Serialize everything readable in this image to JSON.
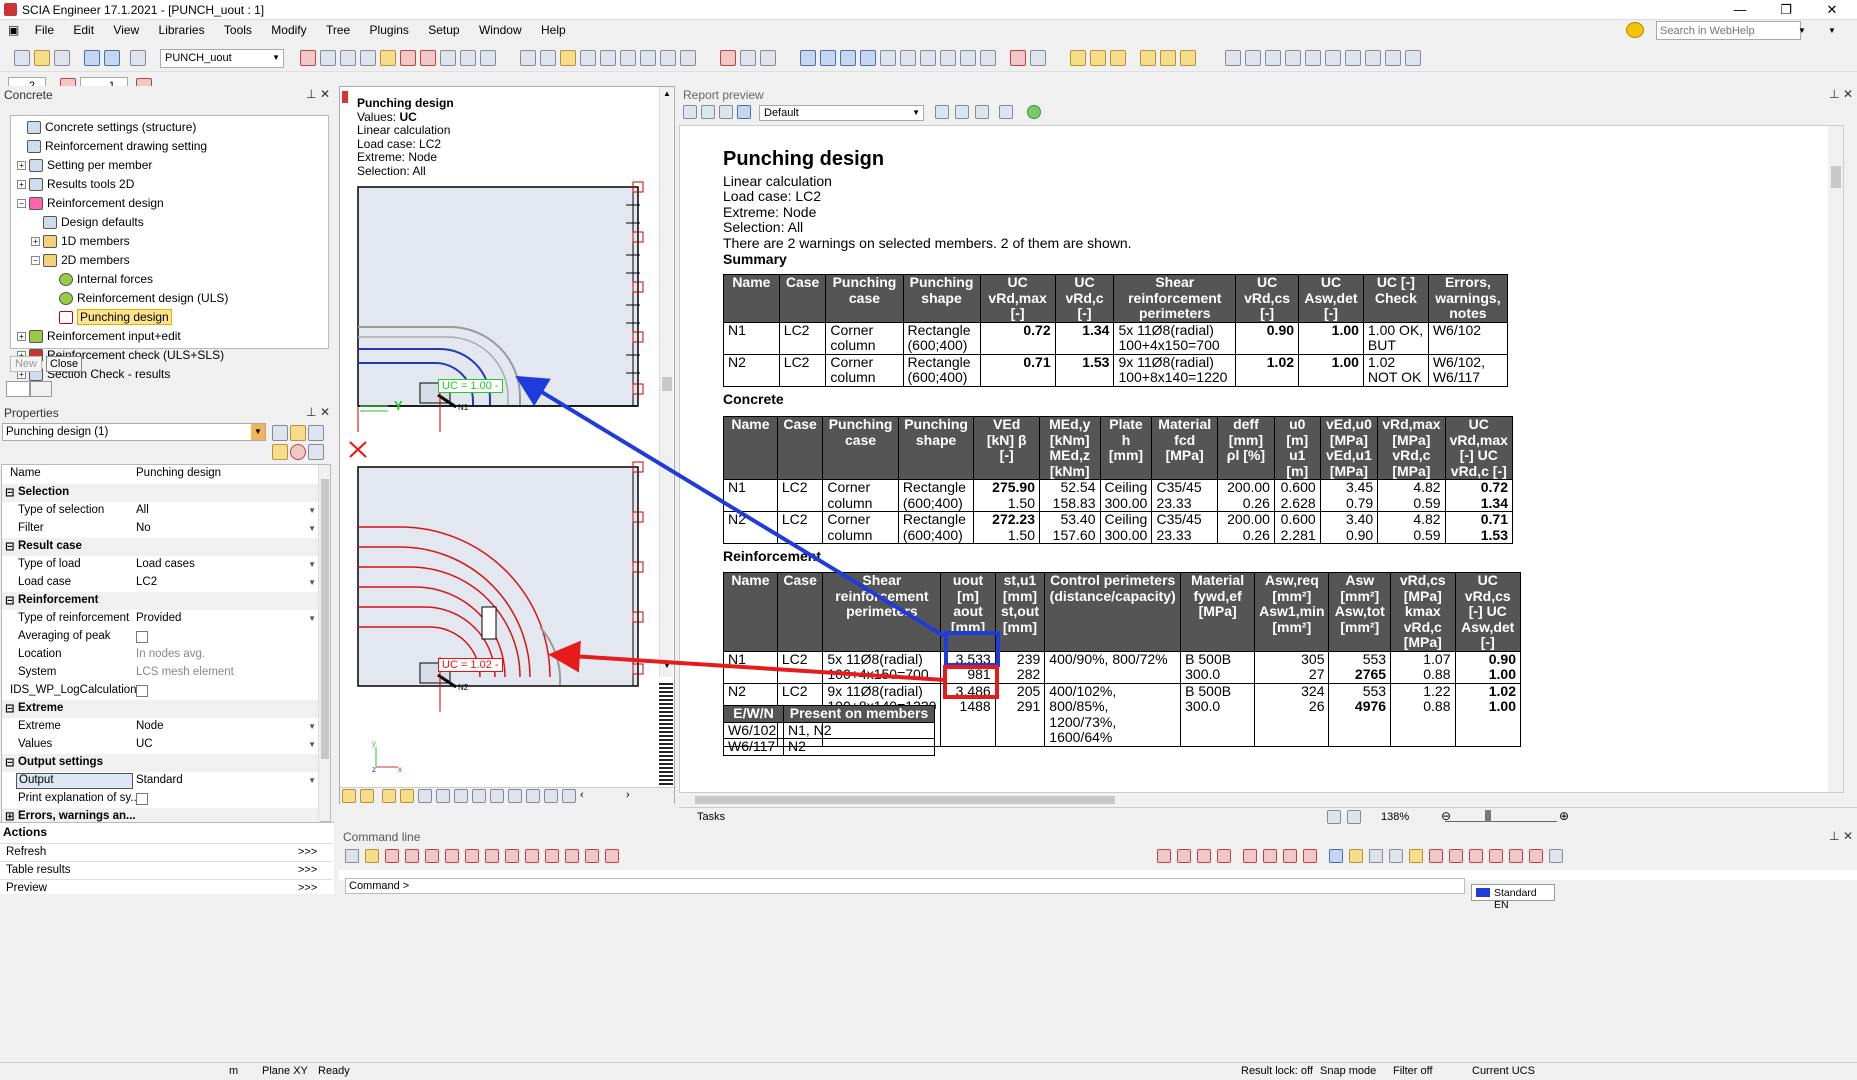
{
  "window": {
    "title": "SCIA Engineer 17.1.2021 - [PUNCH_uout : 1]",
    "min": "—",
    "max": "❐",
    "close": "✕"
  },
  "menu": [
    "File",
    "Edit",
    "View",
    "Libraries",
    "Tools",
    "Modify",
    "Tree",
    "Plugins",
    "Setup",
    "Window",
    "Help"
  ],
  "toolbar": {
    "project_combo": "PUNCH_uout",
    "search_placeholder": "Search in WebHelp",
    "spin1": "2",
    "spin2": "1"
  },
  "concrete_panel": {
    "title": "Concrete",
    "items": [
      {
        "label": "Concrete settings (structure)"
      },
      {
        "label": "Reinforcement drawing setting"
      },
      {
        "label": "Setting per member"
      },
      {
        "label": "Results tools 2D"
      },
      {
        "label": "Reinforcement design"
      },
      {
        "label": "Design defaults"
      },
      {
        "label": "1D members"
      },
      {
        "label": "2D members"
      },
      {
        "label": "Internal forces"
      },
      {
        "label": "Reinforcement design (ULS)"
      },
      {
        "label": "Punching design"
      },
      {
        "label": "Reinforcement input+edit"
      },
      {
        "label": "Reinforcement check (ULS+SLS)"
      },
      {
        "label": "Section Check - results"
      }
    ],
    "new_btn": "New",
    "close_btn": "Close"
  },
  "properties": {
    "title": "Properties",
    "combo": "Punching design (1)",
    "name_key": "Name",
    "name_val": "Punching design",
    "groups": {
      "selection": "Selection",
      "result_case": "Result case",
      "reinforcement": "Reinforcement",
      "extreme": "Extreme",
      "output": "Output settings",
      "errors": "Errors, warnings an..."
    },
    "rows": {
      "type_sel": [
        "Type of selection",
        "All"
      ],
      "filter": [
        "Filter",
        "No"
      ],
      "type_load": [
        "Type of load",
        "Load cases"
      ],
      "load_case": [
        "Load case",
        "LC2"
      ],
      "type_reinf": [
        "Type of reinforcement",
        "Provided"
      ],
      "avg_peak": [
        "Averaging of peak",
        ""
      ],
      "location": [
        "Location",
        "In nodes avg."
      ],
      "system": [
        "System",
        "LCS mesh element"
      ],
      "ids": [
        "IDS_WP_LogCalculation",
        ""
      ],
      "extreme": [
        "Extreme",
        "Node"
      ],
      "values": [
        "Values",
        "UC"
      ],
      "output": [
        "Output",
        "Standard"
      ],
      "print_expl": [
        "Print explanation of sy...",
        ""
      ]
    }
  },
  "actions": {
    "title": "Actions",
    "items": [
      "Refresh",
      "Table results",
      "Preview"
    ],
    "arrows": ">>>"
  },
  "viewport": {
    "lines": [
      "Punching design",
      "Values: UC",
      "Linear calculation",
      "Load case: LC2",
      "Extreme: Node",
      "Selection: All"
    ],
    "label_values": "Values: ",
    "uc_val": "UC",
    "uc1": "UC = 1.00 -",
    "uc2": "UC = 1.02 -",
    "n1": "N1",
    "n2": "N2",
    "axis_y": "Y",
    "axis_small_y": "y",
    "axis_small_x": "x",
    "axis_z": "z"
  },
  "report": {
    "panel_title": "Report preview",
    "combo": "Default",
    "title": "Punching design",
    "lines": [
      "Linear  calculation",
      "Load case: LC2",
      "Extreme: Node",
      "Selection:  All",
      "There are 2 warnings  on selected members. 2 of them are shown."
    ],
    "summary_title": "Summary",
    "concrete_title": "Concrete",
    "reinf_title": "Reinforcement",
    "summary": {
      "headers": [
        "Name",
        "Case",
        "Punching case",
        "Punching shape",
        "UC vRd,max [-]",
        "UC vRd,c [-]",
        "Shear reinforcement perimeters",
        "UC vRd,cs [-]",
        "UC Asw,det [-]",
        "UC [-] Check",
        "Errors, warnings, notes"
      ],
      "rows": [
        [
          "N1",
          "LC2",
          "Corner column",
          "Rectangle (600;400)",
          "0.72",
          "1.34",
          "5x 11Ø8(radial) 100+4x150=700",
          "0.90",
          "1.00",
          "1.00 OK, BUT",
          "W6/102"
        ],
        [
          "N2",
          "LC2",
          "Corner column",
          "Rectangle (600;400)",
          "0.71",
          "1.53",
          "9x 11Ø8(radial) 100+8x140=1220",
          "1.02",
          "1.00",
          "1.02 NOT OK",
          "W6/102, W6/117"
        ]
      ]
    },
    "concrete": {
      "headers": [
        "Name",
        "Case",
        "Punching case",
        "Punching shape",
        "VEd [kN] β [-]",
        "MEd,y [kNm] MEd,z [kNm]",
        "Plate h [mm]",
        "Material fcd [MPa]",
        "deff [mm] ρl [%]",
        "u0 [m] u1 [m]",
        "vEd,u0 [MPa] vEd,u1 [MPa]",
        "vRd,max [MPa] vRd,c [MPa]",
        "UC vRd,max [-] UC vRd,c [-]"
      ],
      "rows": [
        [
          "N1",
          "LC2",
          "Corner column",
          "Rectangle (600;400)",
          "275.90",
          "1.50",
          "52.54",
          "158.83",
          "Ceiling",
          "300.00",
          "C35/45",
          "23.33",
          "200.00",
          "0.26",
          "0.600",
          "2.628",
          "3.45",
          "0.79",
          "4.82",
          "0.59",
          "0.72",
          "1.34"
        ],
        [
          "N2",
          "LC2",
          "Corner column",
          "Rectangle (600;400)",
          "272.23",
          "1.50",
          "53.40",
          "157.60",
          "Ceiling",
          "300.00",
          "C35/45",
          "23.33",
          "200.00",
          "0.26",
          "0.600",
          "2.281",
          "3.40",
          "0.90",
          "4.82",
          "0.59",
          "0.71",
          "1.53"
        ]
      ]
    },
    "reinf": {
      "headers": [
        "Name",
        "Case",
        "Shear reinforcement perimeters",
        "uout [m] aout [mm]",
        "st,u1 [mm] st,out [mm]",
        "Control perimeters (distance/capacity)",
        "Material fywd,ef [MPa]",
        "Asw,req [mm²] Asw1,min [mm²]",
        "Asw [mm²] Asw,tot [mm²]",
        "vRd,cs [MPa] kmax vRd,c [MPa]",
        "UC vRd,cs [-] UC Asw,det [-]"
      ],
      "rows": [
        [
          "N1",
          "LC2",
          "5x 11Ø8(radial)",
          "100+4x150=700",
          "3.533",
          "981",
          "239",
          "282",
          "400/90%, 800/72%",
          "",
          "B 500B",
          "300.0",
          "305",
          "27",
          "553",
          "2765",
          "1.07",
          "0.88",
          "0.90",
          "1.00"
        ],
        [
          "N2",
          "LC2",
          "9x 11Ø8(radial)",
          "100+8x140=1220",
          "3.486",
          "1488",
          "205",
          "291",
          "400/102%, 800/85%,",
          "1200/73%, 1600/64%",
          "B 500B",
          "300.0",
          "324",
          "26",
          "553",
          "4976",
          "1.22",
          "0.88",
          "1.02",
          "1.00"
        ]
      ]
    },
    "legend": {
      "headers": [
        "E/W/N",
        "Present on members"
      ],
      "rows": [
        [
          "W6/102",
          "N1, N2"
        ],
        [
          "W6/117",
          "N2"
        ]
      ]
    },
    "tasks": "Tasks",
    "zoom": "138%"
  },
  "command": {
    "title": "Command line",
    "prompt": "Command >",
    "lang": "Standard EN"
  },
  "status": {
    "unit": "m",
    "plane": "Plane XY",
    "state": "Ready",
    "result_lock": "Result lock: off",
    "snap": "Snap mode",
    "filter": "Filter off",
    "ucs": "Current UCS"
  },
  "colors": {
    "blue_box": "#1f3bdc",
    "red_box": "#e61b1b",
    "selected": "#ffe38a",
    "header_grey": "#555555"
  }
}
